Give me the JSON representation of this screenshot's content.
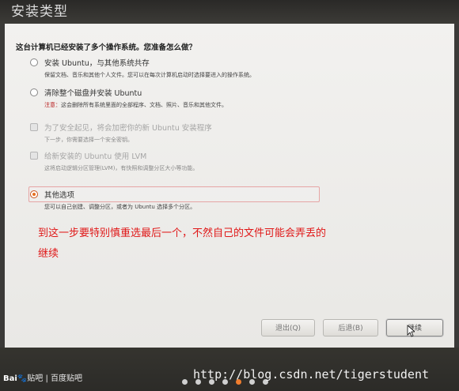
{
  "window": {
    "title": "安装类型"
  },
  "question": "这台计算机已经安装了多个操作系统。您准备怎么做？",
  "options": [
    {
      "label": "安装 Ubuntu，与其他系统共存",
      "desc": "保留文档、音乐和其他个人文件。您可以在每次计算机启动时选择要进入的操作系统。",
      "control": "radio",
      "state": "unselected"
    },
    {
      "label": "清除整个磁盘并安装 Ubuntu",
      "desc_prefix": "注意：",
      "desc": "这会删除所有系统里面的全部程序、文档、照片、音乐和其他文件。",
      "control": "radio",
      "state": "unselected"
    },
    {
      "label": "为了安全起见，将会加密你的新 Ubuntu 安装程序",
      "desc": "下一步，你需要选择一个安全密钥。",
      "control": "checkbox",
      "state": "disabled"
    },
    {
      "label": "给新安装的 Ubuntu 使用 LVM",
      "desc": "这将启动逻辑分区管理(LVM)，有快照和调整分区大小等功能。",
      "control": "checkbox",
      "state": "disabled"
    },
    {
      "label": "其他选项",
      "desc": "您可以自己创建、调整分区，或者为 Ubuntu 选择多个分区。",
      "control": "radio",
      "state": "selected"
    }
  ],
  "annotation": {
    "line1": "到这一步要特别慎重选最后一个，不然自己的文件可能会弄丢的",
    "line2": "继续",
    "color": "#e01818"
  },
  "buttons": {
    "quit": "退出(Q)",
    "back": "后退(B)",
    "continue": "继续"
  },
  "footer": {
    "baidu_brand": "Bai",
    "baidu_suffix": "贴吧",
    "baidu_tieba": "百度贴吧",
    "watermark": "http://blog.csdn.net/tigerstudent",
    "progress_dots": 7,
    "active_dot": 5
  },
  "colors": {
    "accent": "#e5701f",
    "annotation_red": "#e01818",
    "warning_red": "#b71a1a"
  }
}
